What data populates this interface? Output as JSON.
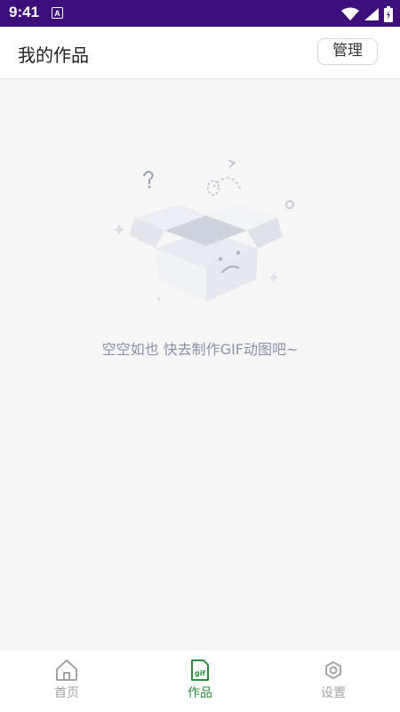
{
  "status_bar": {
    "time": "9:41",
    "indicator": "A",
    "icons": [
      "wifi-icon",
      "signal-icon",
      "battery-icon"
    ]
  },
  "header": {
    "title": "我的作品",
    "manage_label": "管理"
  },
  "empty_state": {
    "illustration": "empty-box-icon",
    "message": "空空如也 快去制作GIF动图吧~"
  },
  "tab_bar": {
    "items": [
      {
        "label": "首页",
        "icon": "home-icon",
        "active": false
      },
      {
        "label": "作品",
        "icon": "gif-file-icon",
        "active": true
      },
      {
        "label": "设置",
        "icon": "gear-icon",
        "active": false
      }
    ]
  },
  "colors": {
    "status_bar": "#3d0f7a",
    "accent": "#2d8a3c",
    "inactive": "#a4a4a4",
    "empty_text": "#8a92a6"
  }
}
